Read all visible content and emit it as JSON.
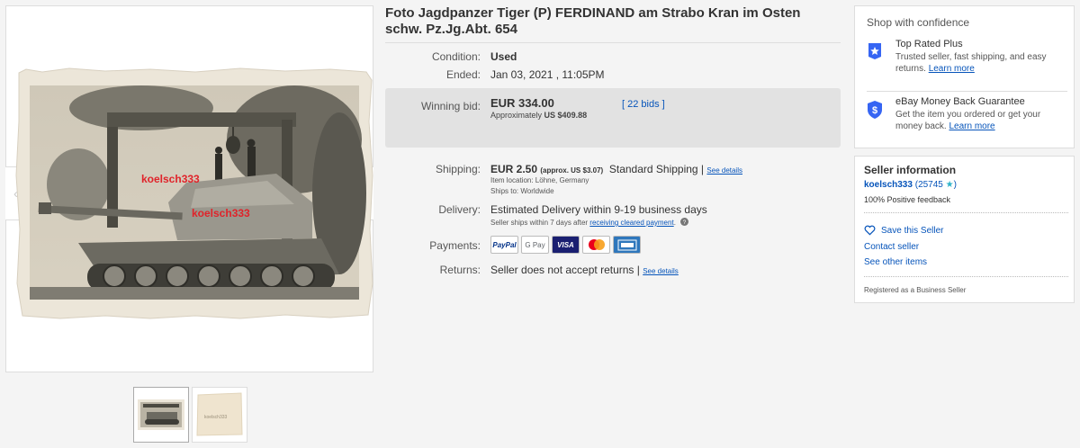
{
  "listing": {
    "title": "Foto Jagdpanzer Tiger (P) FERDINAND am Strabo Kran im Osten schw. Pz.Jg.Abt. 654",
    "watermark": "koelsch333",
    "thumb_watermark": "koelsch333"
  },
  "details": {
    "condition_label": "Condition:",
    "condition_value": "Used",
    "ended_label": "Ended:",
    "ended_value": "Jan 03, 2021 , 11:05PM",
    "winning_bid_label": "Winning bid:",
    "winning_bid_value": "EUR 334.00",
    "approx_prefix": "Approximately",
    "approx_value": "US $409.88",
    "bids_link": "22 bids",
    "shipping_label": "Shipping:",
    "shipping_value": "EUR 2.50",
    "shipping_approx": "(approx. US $3.07)",
    "shipping_method": "Standard Shipping |",
    "shipping_see_details": "See details",
    "item_location": "Item location:  Löhne, Germany",
    "ships_to": "Ships to:  Worldwide",
    "delivery_label": "Delivery:",
    "delivery_value": "Estimated Delivery within 9-19 business days",
    "delivery_note": "Seller ships within 7 days after",
    "delivery_link": "receiving cleared payment",
    "payments_label": "Payments:",
    "payments": [
      "PayPal",
      "G Pay",
      "VISA",
      "Mastercard",
      "AMEX"
    ],
    "returns_label": "Returns:",
    "returns_value": "Seller does not accept returns |",
    "returns_see_details": "See details"
  },
  "confidence": {
    "title": "Shop with confidence",
    "top_rated_head": "Top Rated Plus",
    "top_rated_desc": "Trusted seller, fast shipping, and easy returns.",
    "top_rated_link": "Learn more",
    "guarantee_head": "eBay Money Back Guarantee",
    "guarantee_desc": "Get the item you ordered or get your money back.",
    "guarantee_link": "Learn more"
  },
  "seller": {
    "title": "Seller information",
    "name": "koelsch333",
    "score_open": "(",
    "score": "25745",
    "score_close": ")",
    "feedback": "100% Positive feedback",
    "save": "Save this Seller",
    "contact": "Contact seller",
    "other_items": "See other items",
    "business": "Registered as a Business Seller"
  },
  "colors": {
    "link": "#0654ba",
    "watermark": "#e0232a",
    "star": "#2fb3c9",
    "badge": "#3665f3"
  }
}
